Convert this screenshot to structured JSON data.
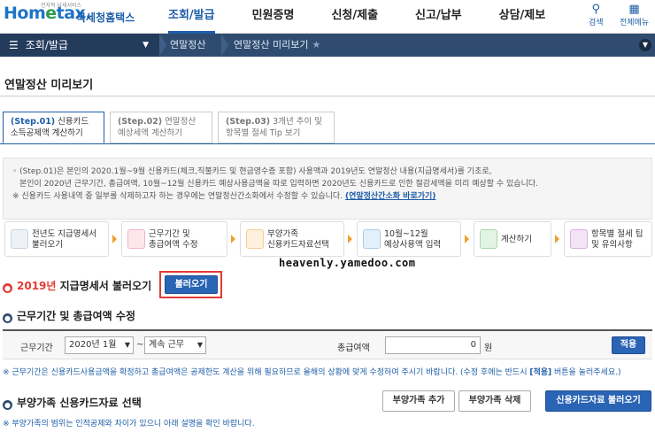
{
  "header": {
    "logo_text_a": "Hom",
    "logo_text_e": "e",
    "logo_text_b": "tax.",
    "logo_sub": "전자적 납세서비스",
    "logo_kor": "국세청홈택스",
    "nav": [
      "조회/발급",
      "민원증명",
      "신청/제출",
      "신고/납부",
      "상담/제보"
    ],
    "search_label": "검색",
    "menu_label": "전체메뉴"
  },
  "breadcrumb": {
    "home": "조회/발급",
    "seg1": "연말정산",
    "seg2": "연말정산 미리보기"
  },
  "page_title": "연말정산 미리보기",
  "tabs": [
    {
      "step": "(Step.01)",
      "line1": "신용카드",
      "line2": "소득공제액 계산하기"
    },
    {
      "step": "(Step.02)",
      "line1": "연말정산",
      "line2": "예상세액 계산하기"
    },
    {
      "step": "(Step.03)",
      "line1": "3개년 추이 및",
      "line2": "항목별 절세 Tip 보기"
    }
  ],
  "info": {
    "line1": "◦ (Step.01)은 본인의 2020.1월~9월 신용카드(체크,직불카드 및 현금영수증 포함) 사용액과 2019년도 연말정산 내용(지급명세서)를 기초로,",
    "line2": "본인이 2020년 근무기간, 총급여액, 10월~12월 신용카드 예상사용금액을 따로 입력하면 2020년도 신용카드로 인한 절감세액을 미리 예상할 수 있습니다.",
    "line3": "※ 신용카드 사용내역 중 일부를 삭제하고자 하는 경우에는 연말정산간소화에서 수정할 수 있습니다.",
    "link": "(연말정산간소화 바로가기)"
  },
  "steps": [
    {
      "line1": "전년도 지급명세서",
      "line2": "불러오기"
    },
    {
      "line1": "근무기간 및",
      "line2": "총급여액 수정"
    },
    {
      "line1": "부양가족",
      "line2": "신용카드자료선택"
    },
    {
      "line1": "10월~12월",
      "line2": "예상사용액 입력"
    },
    {
      "line1": "계산하기",
      "line2": ""
    },
    {
      "line1": "항목별 절세 팁",
      "line2": "및 유의사항"
    }
  ],
  "watermark": "heavenly.yamedoo.com",
  "section1": {
    "year": "2019년",
    "title": "지급명세서 불러오기",
    "button": "불러오기"
  },
  "section2": {
    "title": "근무기간 및 총급여액 수정"
  },
  "form": {
    "period_label": "근무기간",
    "period_start": "2020년 1월",
    "tilde": "~",
    "period_end": "계속 근무",
    "salary_label": "총급여액",
    "salary_value": "0",
    "unit": "원",
    "apply_button": "적용"
  },
  "note1_a": "※ 근무기간은 신용카드사용금액을 확정하고 총급여액은 공제한도 계산을 위해 필요하므로 올해의 상황에 맞게 수정하여 주시기 바랍니다. (수정 후에는 반드시 ",
  "note1_b": "[적용]",
  "note1_c": " 버튼을 눌러주세요.)",
  "section3": {
    "title": "부양가족 신용카드자료 선택"
  },
  "note2": "※ 부양가족의 범위는 인적공제와 차이가 있으니 아래 설명을 확인 바랍니다.",
  "buttons": {
    "add_family": "부양가족 추가",
    "delete_family": "부양가족 삭제",
    "load_card": "신용카드자료 불러오기"
  },
  "colors": {
    "brand_blue": "#1d5da8",
    "bar_dark": "#2f4c70",
    "accent_red": "#e53935"
  }
}
